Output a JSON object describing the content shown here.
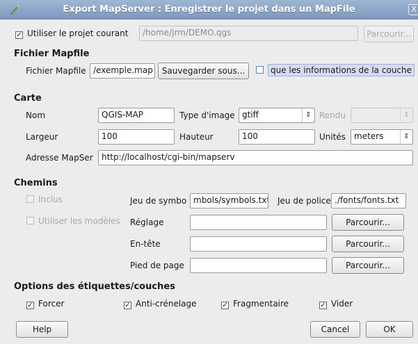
{
  "window": {
    "title": "Export MapServer : Enregistrer le projet dans un MapFile",
    "close_symbol": "X"
  },
  "project": {
    "use_current_label": "Utiliser le projet courant",
    "use_current_checked": true,
    "path_value": "/home/jrm/DEMO.qgs",
    "browse_label": "Parcourir..."
  },
  "mapfile": {
    "section_title": "Fichier Mapfile",
    "label": "Fichier Mapfile",
    "value": "/exemple.map",
    "save_as_label": "Sauvegarder sous...",
    "layer_info_label": "que les informations de la couche",
    "layer_info_checked": false
  },
  "carte": {
    "section_title": "Carte",
    "name_label": "Nom",
    "name_value": "QGIS-MAP",
    "image_type_label": "Type d'image",
    "image_type_value": "gtiff",
    "render_label": "Rendu",
    "render_value": "",
    "width_label": "Largeur",
    "width_value": "100",
    "height_label": "Hauteur",
    "height_value": "100",
    "units_label": "Unités",
    "units_value": "meters",
    "mapserver_label": "Adresse MapSer",
    "mapserver_value": "http://localhost/cgi-bin/mapserv"
  },
  "chemins": {
    "section_title": "Chemins",
    "inclus_label": "Inclus",
    "use_templates_label": "Utiliser les modèles",
    "symbols_label": "Jeu de symbo",
    "symbols_value": "mbols/symbols.txt",
    "fonts_label": "Jeu de police",
    "fonts_value": "./fonts/fonts.txt",
    "template_label": "Réglage",
    "template_value": "",
    "header_label": "En-tête",
    "header_value": "",
    "footer_label": "Pied de page",
    "footer_value": "",
    "browse_label": "Parcourir..."
  },
  "options": {
    "section_title": "Options des étiquettes/couches",
    "items": [
      {
        "label": "Forcer",
        "checked": true
      },
      {
        "label": "Anti-crénelage",
        "checked": true
      },
      {
        "label": "Fragmentaire",
        "checked": true
      },
      {
        "label": "Vider",
        "checked": true
      }
    ]
  },
  "footer": {
    "help_label": "Help",
    "cancel_label": "Cancel",
    "ok_label": "OK"
  },
  "check_mark": "✓"
}
